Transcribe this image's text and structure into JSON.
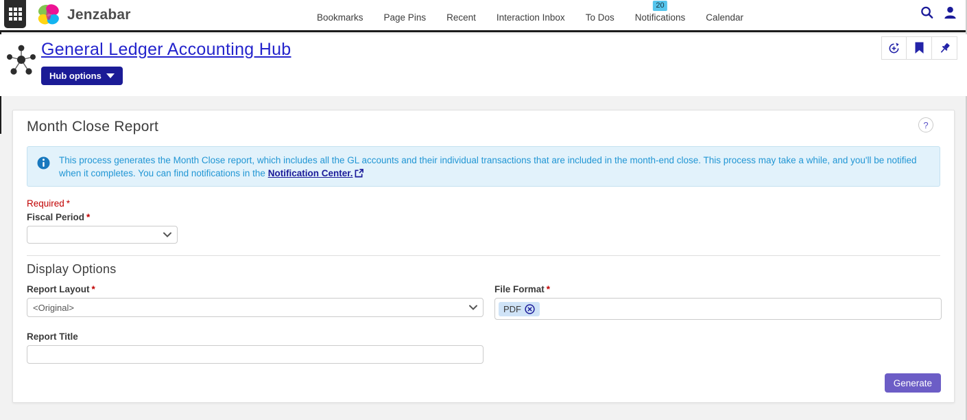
{
  "topbar": {
    "brand": "Jenzabar",
    "nav": [
      "Bookmarks",
      "Page Pins",
      "Recent",
      "Interaction Inbox",
      "To Dos",
      "Notifications",
      "Calendar"
    ],
    "notifications_badge": "20"
  },
  "hub": {
    "title": "General Ledger Accounting Hub",
    "options_button": "Hub options"
  },
  "report": {
    "title": "Month Close Report",
    "help": "?",
    "info_text": "This process generates the Month Close report, which includes all the GL accounts and their individual transactions that are included in the month-end close. This process may take a while, and you'll be notified when it completes. You can find notifications in the",
    "info_link": "Notification Center.",
    "required_note": "Required",
    "required_mark": "*",
    "fiscal_period_label": "Fiscal Period",
    "fiscal_period_value": "",
    "display_options_heading": "Display Options",
    "report_layout_label": "Report Layout",
    "report_layout_value": "<Original>",
    "file_format_label": "File Format",
    "file_format_tag": "PDF",
    "report_title_label": "Report Title",
    "report_title_value": "",
    "generate_button": "Generate"
  },
  "colors": {
    "accent_navy": "#1b1b96",
    "link_blue": "#2424cc",
    "alert_blue": "#2196d4",
    "required_red": "#c00000",
    "generate_purple": "#6c5dc6",
    "badge_blue": "#56c5ec"
  }
}
